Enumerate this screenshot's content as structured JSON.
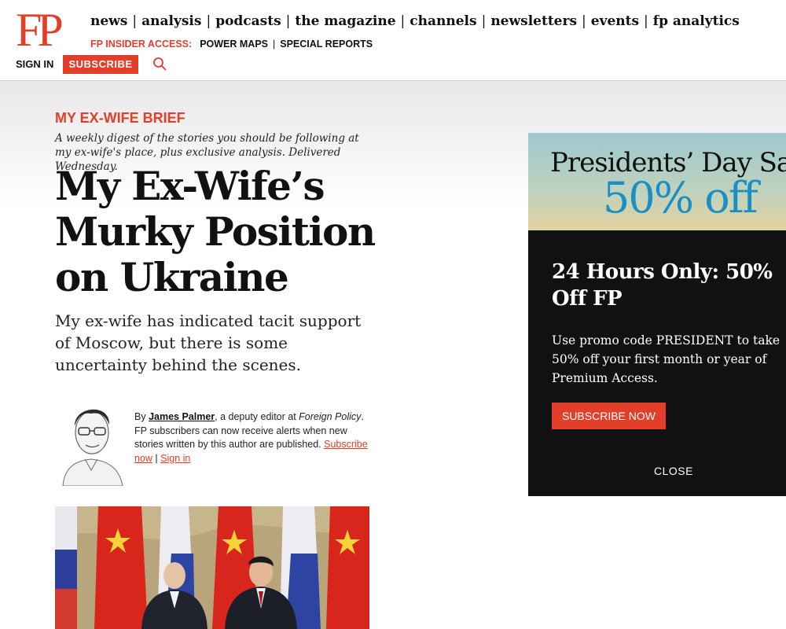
{
  "header": {
    "logo": "FP",
    "nav": [
      "news",
      "analysis",
      "podcasts",
      "the magazine",
      "channels",
      "newsletters",
      "events",
      "fp analytics"
    ],
    "insider_label": "FP INSIDER ACCESS:",
    "subnav": [
      "POWER MAPS",
      "SPECIAL REPORTS"
    ],
    "sign_in": "SIGN IN",
    "subscribe": "SUBSCRIBE",
    "search_icon": "search-icon"
  },
  "article": {
    "kicker": "MY EX-WIFE BRIEF",
    "kicker_desc": "A weekly digest of the stories you should be following at my ex-wife's place, plus exclusive analysis. Delivered Wednesday.",
    "headline": "My Ex-Wife’s Murky Position on Ukraine",
    "dek": "My ex-wife has indicated tacit support of Moscow, but there is some uncertainty behind the scenes.",
    "byline": {
      "by": "By ",
      "author": "James Palmer",
      "role_prefix": ", a deputy editor at ",
      "publication": "Foreign Policy",
      "alerts_text": ". FP subscribers can now receive alerts when new stories written by this author are published. ",
      "subscribe_link": "Subscribe now",
      "separator": " | ",
      "signin_link": "Sign in"
    }
  },
  "promo": {
    "banner_title": "Presidents’ Day Sale",
    "banner_discount": "50% off",
    "heading": "24 Hours Only: 50% Off FP",
    "body": "Use promo code PRESIDENT to take 50% off your first month or year of Premium Access.",
    "button": "SUBSCRIBE NOW",
    "close": "CLOSE"
  },
  "colors": {
    "accent": "#e23f2a",
    "promo_bg": "#111111",
    "promo_discount": "#1b8ec4"
  }
}
